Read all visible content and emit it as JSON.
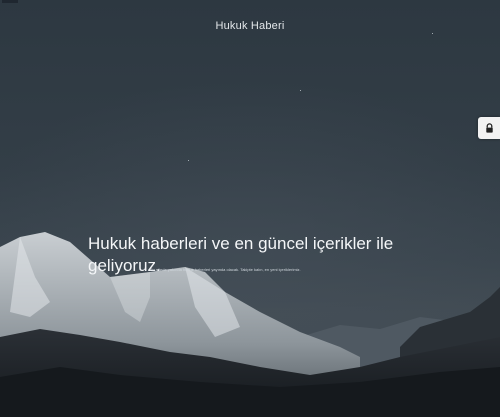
{
  "header": {
    "site_title": "Hukuk Haberi"
  },
  "hero": {
    "headline": "Hukuk haberleri ve en güncel içerikler ile geliyoruz.",
    "subline": "Bu sitede yakında hukuk haberleri yayında olacak. Takipte kalın, en yeni içeriklerimiz."
  },
  "widgets": {
    "lock_icon": "lock-icon"
  },
  "colors": {
    "sky": "#303a43",
    "lock_bg": "#f2f2f2"
  }
}
